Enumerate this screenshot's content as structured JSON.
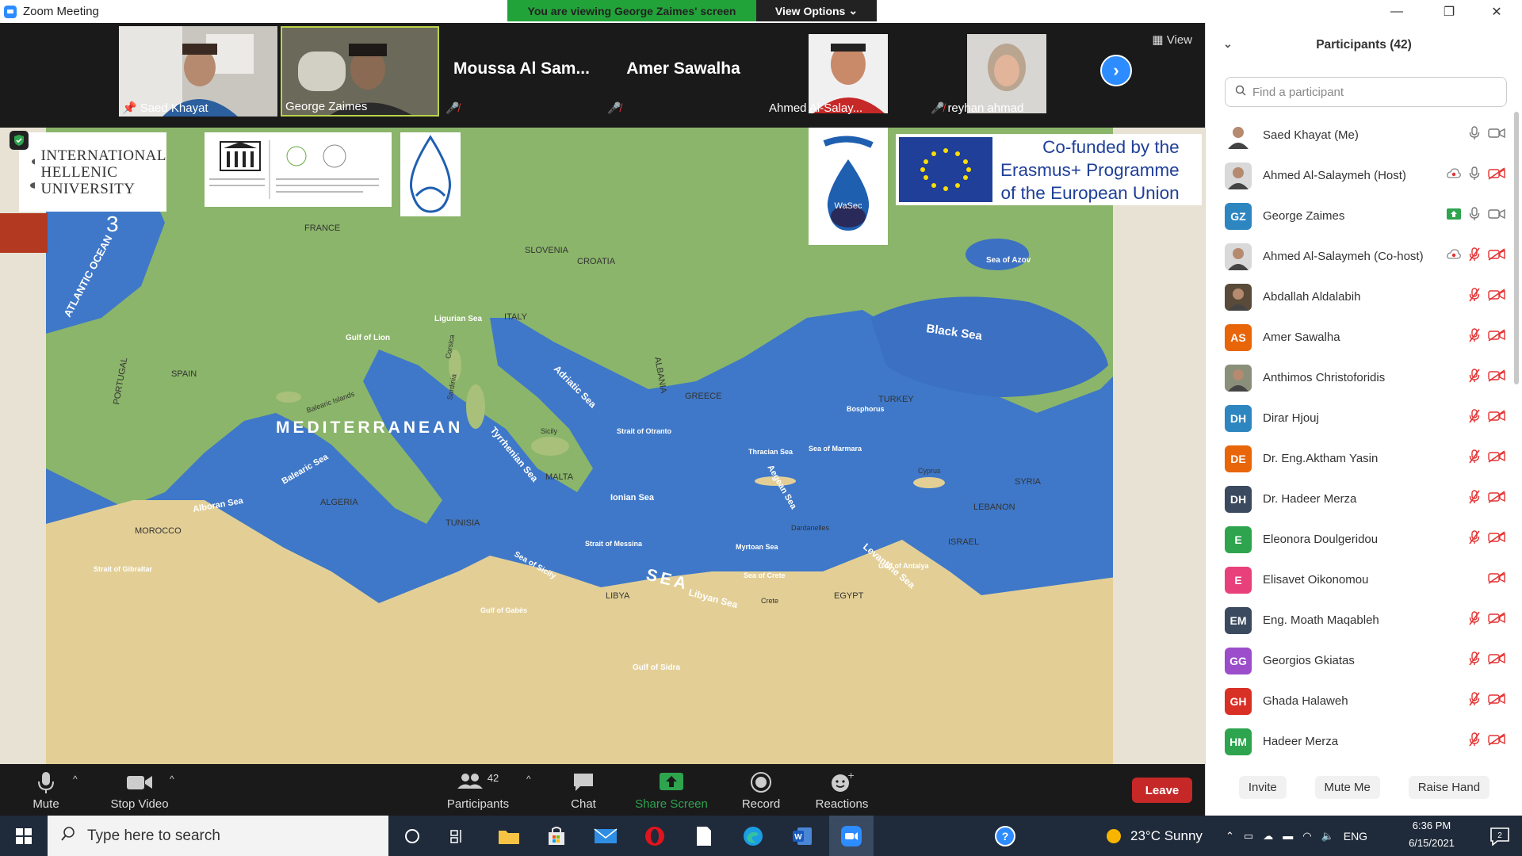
{
  "window": {
    "title": "Zoom Meeting",
    "minimize": "—",
    "restore": "❐",
    "close": "✕"
  },
  "banner": {
    "viewing": "You are viewing George Zaimes' screen",
    "options": "View Options"
  },
  "strip": {
    "view_label": "View",
    "tiles": [
      {
        "name": "Saed Khayat",
        "kind": "video"
      },
      {
        "name": "George Zaimes",
        "kind": "video"
      },
      {
        "name": "Moussa Al Sam...",
        "kind": "text"
      },
      {
        "name": "Amer Sawalha",
        "kind": "text"
      },
      {
        "name": "Ahmed Al-Salay...",
        "kind": "photo"
      },
      {
        "name": "reyhan ahmad",
        "kind": "photo"
      }
    ]
  },
  "slide": {
    "page_number": "3",
    "ihu": [
      "INTERNATIONAL",
      "HELLENIC",
      "UNIVERSITY"
    ],
    "eu": [
      "Co-funded by the",
      "Erasmus+ Programme",
      "of the European Union"
    ],
    "wasec": "WaSec",
    "map_labels": {
      "atlantic": "ATLANTIC OCEAN",
      "france": "FRANCE",
      "slovenia": "SLOVENIA",
      "croatia": "CROATIA",
      "italy": "ITALY",
      "spain": "SPAIN",
      "portugal": "PORTUGAL",
      "albania": "ALBANIA",
      "greece": "GREECE",
      "turkey": "TURKEY",
      "syria": "SYRIA",
      "lebanon": "LEBANON",
      "israel": "ISRAEL",
      "algeria": "ALGERIA",
      "morocco": "MOROCCO",
      "tunisia": "TUNISIA",
      "malta": "MALTA",
      "libya": "LIBYA",
      "egypt": "EGYPT",
      "mediterranean": "MEDITERRANEAN",
      "sea": "SEA",
      "black_sea": "Black Sea",
      "adriatic": "Adriatic Sea",
      "tyrrhenian": "Tyrrhenian Sea",
      "ionian": "Ionian Sea",
      "aegean": "Aegean Sea",
      "levantine": "Levantine Sea",
      "libyan": "Libyan Sea",
      "alboran": "Alboran Sea",
      "balearic": "Balearic Sea",
      "ligurian": "Ligurian Sea",
      "gulf_lion": "Gulf of Lion",
      "azov": "Sea of Azov",
      "bosphorus": "Bosphorus",
      "marmara": "Sea of Marmara",
      "thracian": "Thracian Sea",
      "dardanelles": "Dardanelles",
      "myrtoan": "Myrtoan Sea",
      "crete_sea": "Sea of Crete",
      "crete": "Crete",
      "cyprus": "Cyprus",
      "antalya": "Gulf of Antalya",
      "sidra": "Gulf of Sidra",
      "gabes": "Gulf of Gabès",
      "gibraltar": "Strait of Gibraltar",
      "messina": "Strait of Messina",
      "otranto": "Strait of Otranto",
      "sicily_sea": "Sea of Sicily",
      "sicily": "Sicily",
      "sardinia": "Sardinia",
      "corsica": "Corsica",
      "balearic_isl": "Balearic Islands"
    }
  },
  "controls": {
    "mute": "Mute",
    "stop_video": "Stop Video",
    "participants": "Participants",
    "participants_count": "42",
    "chat": "Chat",
    "share_screen": "Share Screen",
    "record": "Record",
    "reactions": "Reactions",
    "leave": "Leave"
  },
  "panel": {
    "title": "Participants (42)",
    "search_placeholder": "Find a participant",
    "participants": [
      {
        "name": "Saed Khayat (Me)",
        "initials": "",
        "color": "#ffffff",
        "photo": true,
        "mic": "on",
        "video": "on"
      },
      {
        "name": "Ahmed Al-Salaymeh (Host)",
        "initials": "",
        "color": "#d9d9d9",
        "photo": true,
        "mic": "on",
        "video": "off",
        "extra": "record"
      },
      {
        "name": "George Zaimes",
        "initials": "GZ",
        "color": "#2e86c1",
        "mic": "on",
        "video": "on",
        "extra": "share"
      },
      {
        "name": "Ahmed Al-Salaymeh (Co-host)",
        "initials": "",
        "color": "#d9d9d9",
        "photo": true,
        "mic": "off",
        "video": "off",
        "extra": "record"
      },
      {
        "name": "Abdallah Aldalabih",
        "initials": "",
        "color": "#5a4a3a",
        "photo": true,
        "mic": "off",
        "video": "off"
      },
      {
        "name": "Amer Sawalha",
        "initials": "AS",
        "color": "#e8650a",
        "mic": "off",
        "video": "off"
      },
      {
        "name": "Anthimos Christoforidis",
        "initials": "",
        "color": "#8a8f7a",
        "photo": true,
        "mic": "off",
        "video": "off"
      },
      {
        "name": "Dirar Hjouj",
        "initials": "DH",
        "color": "#2e86c1",
        "mic": "off",
        "video": "off"
      },
      {
        "name": "Dr. Eng.Aktham Yasin",
        "initials": "DE",
        "color": "#e8650a",
        "mic": "off",
        "video": "off"
      },
      {
        "name": "Dr. Hadeer Merza",
        "initials": "DH",
        "color": "#3b4a5e",
        "mic": "off",
        "video": "off"
      },
      {
        "name": "Eleonora Doulgeridou",
        "initials": "E",
        "color": "#2ea44f",
        "mic": "off",
        "video": "off"
      },
      {
        "name": "Elisavet Oikonomou",
        "initials": "E",
        "color": "#e8407a",
        "mic": "none",
        "video": "off"
      },
      {
        "name": "Eng. Moath Maqableh",
        "initials": "EM",
        "color": "#3b4a5e",
        "mic": "off",
        "video": "off"
      },
      {
        "name": "Georgios Gkiatas",
        "initials": "GG",
        "color": "#9b4dca",
        "mic": "off",
        "video": "off"
      },
      {
        "name": "Ghada Halaweh",
        "initials": "GH",
        "color": "#d93025",
        "mic": "off",
        "video": "off"
      },
      {
        "name": "Hadeer Merza",
        "initials": "HM",
        "color": "#2ea44f",
        "mic": "off",
        "video": "off"
      }
    ],
    "invite": "Invite",
    "mute_me": "Mute Me",
    "raise_hand": "Raise Hand"
  },
  "taskbar": {
    "search_placeholder": "Type here to search",
    "weather": "23°C  Sunny",
    "lang": "ENG",
    "time": "6:36 PM",
    "date": "6/15/2021",
    "notifications": "2"
  },
  "colors": {
    "accent": "#2d8cff",
    "leave": "#c62828",
    "banner_green": "#22a33a",
    "muted": "#e33333"
  }
}
